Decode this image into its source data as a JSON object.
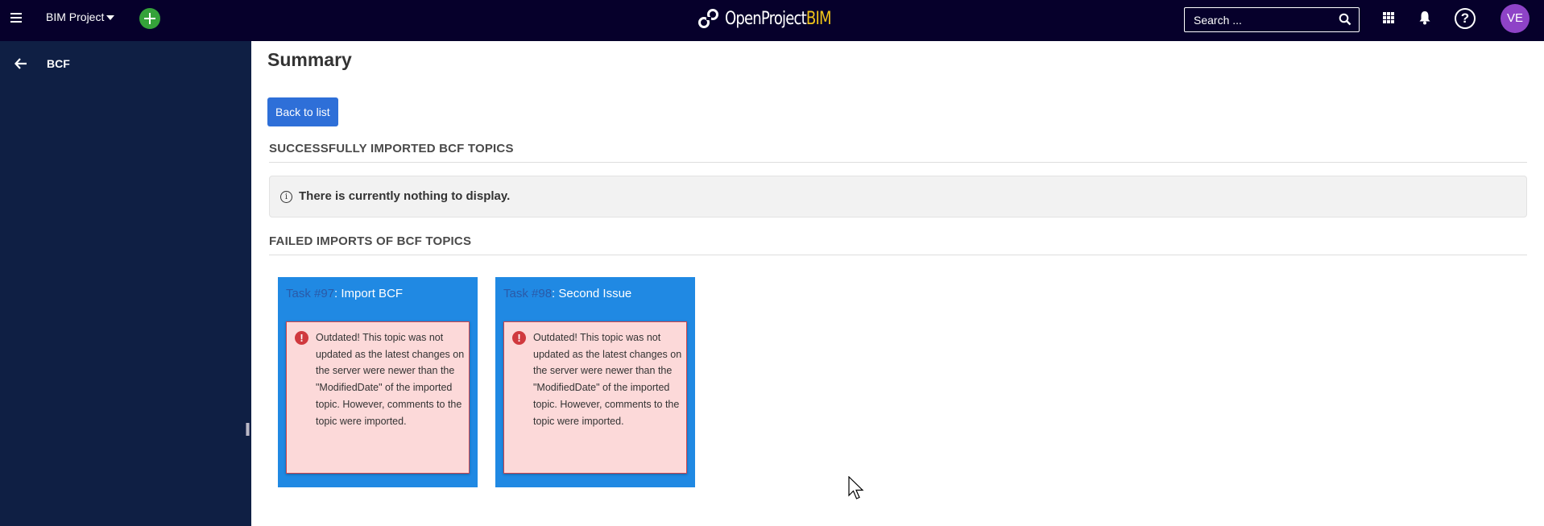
{
  "header": {
    "project_name": "BIM Project",
    "logo_text": "OpenProject",
    "logo_accent": "BIM",
    "search_placeholder": "Search ...",
    "help_label": "?",
    "avatar_initials": "VE",
    "colors": {
      "background": "#06002b",
      "accent": "#f0c419",
      "avatar": "#8e43c7",
      "add_button": "#35a23a"
    }
  },
  "sidebar": {
    "title": "BCF"
  },
  "main": {
    "page_title": "Summary",
    "back_button": "Back to list",
    "success_section": {
      "title": "SUCCESSFULLY IMPORTED BCF TOPICS",
      "empty_message": "There is currently nothing to display."
    },
    "failed_section": {
      "title": "FAILED IMPORTS OF BCF TOPICS",
      "items": [
        {
          "task_ref": "Task #97",
          "subject": ": Import BCF",
          "error": "Outdated! This topic was not updated as the latest changes on the server were newer than the \"ModifiedDate\" of the imported topic. However, comments to the topic were imported."
        },
        {
          "task_ref": "Task #98",
          "subject": ": Second Issue",
          "error": "Outdated! This topic was not updated as the latest changes on the server were newer than the \"ModifiedDate\" of the imported topic. However, comments to the topic were imported."
        }
      ]
    }
  }
}
